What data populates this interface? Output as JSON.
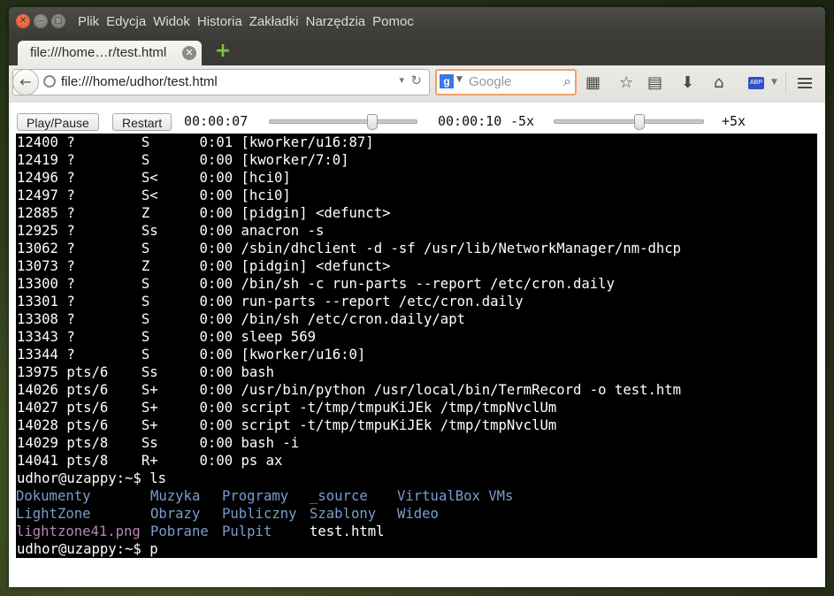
{
  "window": {
    "menu": [
      "Plik",
      "Edycja",
      "Widok",
      "Historia",
      "Zakładki",
      "Narzędzia",
      "Pomoc"
    ]
  },
  "tab": {
    "title": "file:///home…r/test.html"
  },
  "navbar": {
    "url": "file:///home/udhor/test.html",
    "search_placeholder": "Google"
  },
  "player": {
    "play_pause_label": "Play/Pause",
    "restart_label": "Restart",
    "current_time": "00:00:07",
    "total_time": "00:00:10",
    "speed_min": "-5x",
    "speed_max": "+5x",
    "progress": 0.7,
    "speed_level": 0.57
  },
  "terminal": {
    "lines": [
      "12400 ?        S      0:01 [kworker/u16:87]",
      "12419 ?        S      0:00 [kworker/7:0]",
      "12496 ?        S<     0:00 [hci0]",
      "12497 ?        S<     0:00 [hci0]",
      "12885 ?        Z      0:00 [pidgin] <defunct>",
      "12925 ?        Ss     0:00 anacron -s",
      "13062 ?        S      0:00 /sbin/dhclient -d -sf /usr/lib/NetworkManager/nm-dhcp",
      "13073 ?        Z      0:00 [pidgin] <defunct>",
      "13300 ?        S      0:00 /bin/sh -c run-parts --report /etc/cron.daily",
      "13301 ?        S      0:00 run-parts --report /etc/cron.daily",
      "13308 ?        S      0:00 /bin/sh /etc/cron.daily/apt",
      "13343 ?        S      0:00 sleep 569",
      "13344 ?        S      0:00 [kworker/u16:0]",
      "13975 pts/6    Ss     0:00 bash",
      "14026 pts/6    S+     0:00 /usr/bin/python /usr/local/bin/TermRecord -o test.htm",
      "14027 pts/6    S+     0:00 script -t/tmp/tmpuKiJEk /tmp/tmpNvclUm",
      "14028 pts/6    S+     0:00 script -t/tmp/tmpuKiJEk /tmp/tmpNvclUm",
      "14029 pts/8    Ss     0:00 bash -i",
      "14041 pts/8    R+     0:00 ps ax",
      "udhor@uzappy:~$ ls"
    ],
    "ls_rows": [
      [
        {
          "name": "Dokumenty",
          "type": "dir"
        },
        {
          "name": "Muzyka",
          "type": "dir"
        },
        {
          "name": "Programy",
          "type": "dir"
        },
        {
          "name": "_source",
          "type": "dir"
        },
        {
          "name": "VirtualBox VMs",
          "type": "dir"
        }
      ],
      [
        {
          "name": "LightZone",
          "type": "dir"
        },
        {
          "name": "Obrazy",
          "type": "dir"
        },
        {
          "name": "Publiczny",
          "type": "dir"
        },
        {
          "name": "Szablony",
          "type": "dir"
        },
        {
          "name": "Wideo",
          "type": "dir"
        }
      ],
      [
        {
          "name": "lightzone41.png",
          "type": "img"
        },
        {
          "name": "Pobrane",
          "type": "dir"
        },
        {
          "name": "Pulpit",
          "type": "dir"
        },
        {
          "name": "test.html",
          "type": "file"
        }
      ]
    ],
    "prompt_line": "udhor@uzappy:~$ p",
    "colors": {
      "background": "#000000",
      "text": "#ffffff",
      "dir": "#7b9ccd",
      "img": "#b487b4"
    }
  }
}
